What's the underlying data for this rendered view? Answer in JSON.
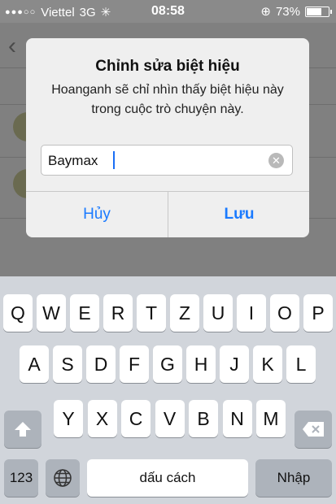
{
  "status_bar": {
    "carrier": "Viettel",
    "network": "3G",
    "time": "08:58",
    "battery": "73%",
    "battery_level": 0.73
  },
  "dialog": {
    "title": "Chỉnh sửa biệt hiệu",
    "message": "Hoanganh sẽ chỉ nhìn thấy biệt hiệu này trong cuộc trò chuyện này.",
    "input_value": "Baymax",
    "cancel_label": "Hủy",
    "save_label": "Lưu"
  },
  "keyboard": {
    "row1": [
      "Q",
      "W",
      "E",
      "R",
      "T",
      "Z",
      "U",
      "I",
      "O",
      "P"
    ],
    "row2": [
      "A",
      "S",
      "D",
      "F",
      "G",
      "H",
      "J",
      "K",
      "L"
    ],
    "row3": [
      "Y",
      "X",
      "C",
      "V",
      "B",
      "N",
      "M"
    ],
    "numbers_label": "123",
    "space_label": "dấu cách",
    "return_label": "Nhập"
  },
  "colors": {
    "accent": "#1a7aff"
  }
}
